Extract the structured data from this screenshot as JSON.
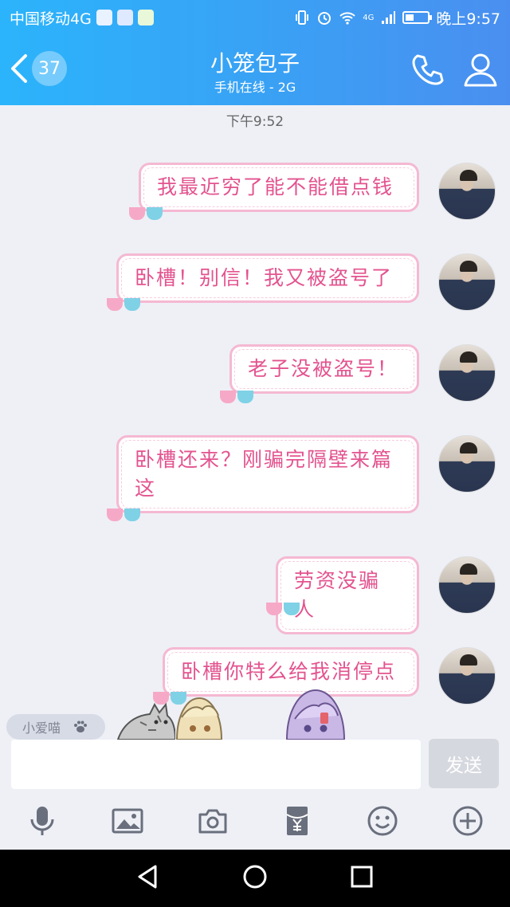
{
  "status_bar": {
    "carrier": "中国移动4G",
    "clock": "晚上9:57",
    "network_badge": "4G"
  },
  "header": {
    "unread_count": "37",
    "title": "小笼包子",
    "subtitle": "手机在线 - 2G",
    "back_icon": "chevron-left-icon",
    "call_icon": "phone-icon",
    "profile_icon": "user-icon"
  },
  "chat": {
    "timestamp": "下午9:52",
    "messages": [
      {
        "text": "我最近穷了能不能借点钱"
      },
      {
        "text": "卧槽！别信！我又被盗号了"
      },
      {
        "text": "老子没被盗号！"
      },
      {
        "text": "卧槽还来？刚骗完隔壁来篇这"
      },
      {
        "text": "劳资没骗人"
      },
      {
        "text": "卧槽你特么给我消停点"
      }
    ],
    "colors": {
      "bubble_border": "#f5b8d2",
      "bubble_text": "#e3538f"
    }
  },
  "sticker_bar": {
    "nickname": "小爱喵",
    "paw_icon": "paw-icon"
  },
  "composer": {
    "placeholder": "",
    "send_label": "发送"
  },
  "toolbar": {
    "icons": [
      "microphone-icon",
      "image-icon",
      "camera-icon",
      "red-packet-icon",
      "emoji-icon",
      "plus-icon"
    ]
  },
  "nav": {
    "icons": [
      "back-triangle-icon",
      "home-circle-icon",
      "recents-square-icon"
    ]
  },
  "theme": {
    "header_gradient_start": "#2bb4fb",
    "header_gradient_end": "#4a8ff0",
    "background": "#eef0f6"
  }
}
